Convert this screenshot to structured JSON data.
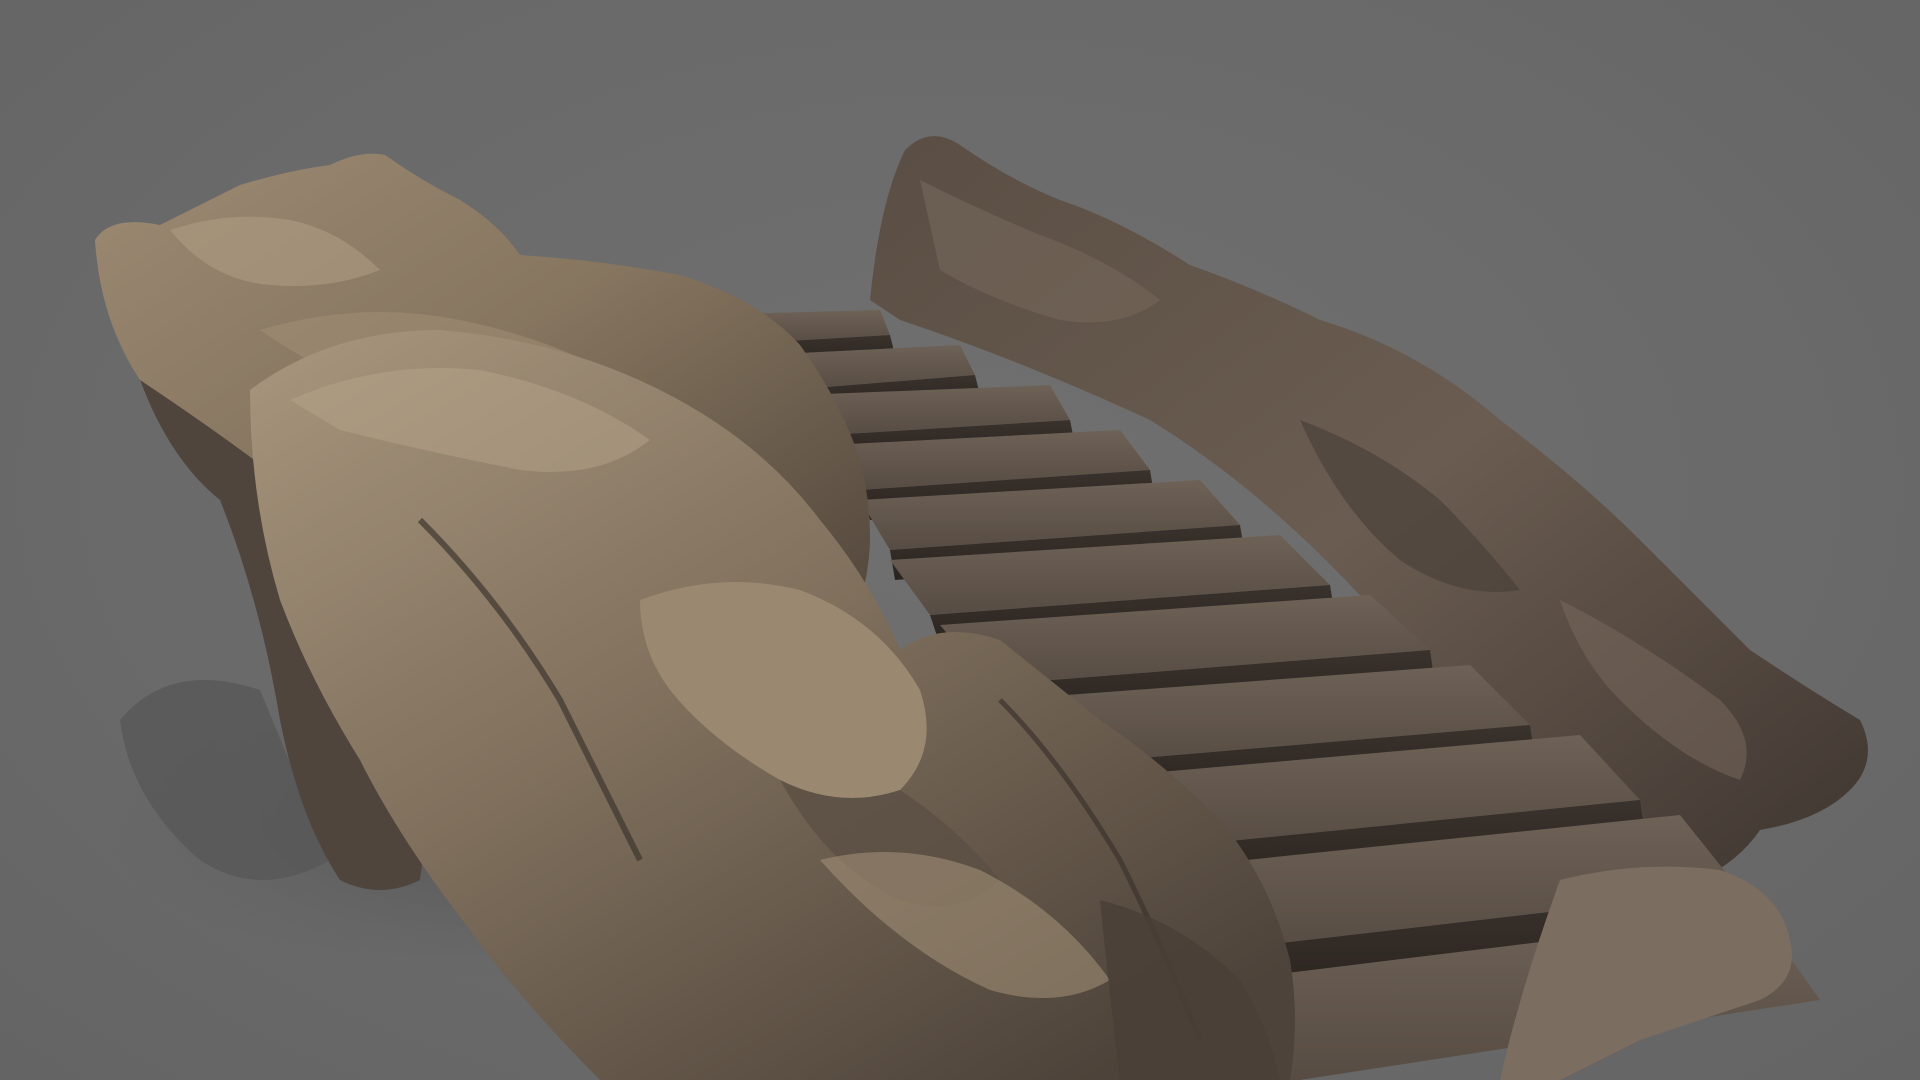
{
  "scene": {
    "subject": "rock-staircase-3d-model",
    "background_color": "#6b6b6b",
    "rock_colors": {
      "light": "#a3917a",
      "mid": "#7d6e5c",
      "dark": "#4a4037",
      "deep": "#2f2924"
    },
    "step_count": 11
  }
}
